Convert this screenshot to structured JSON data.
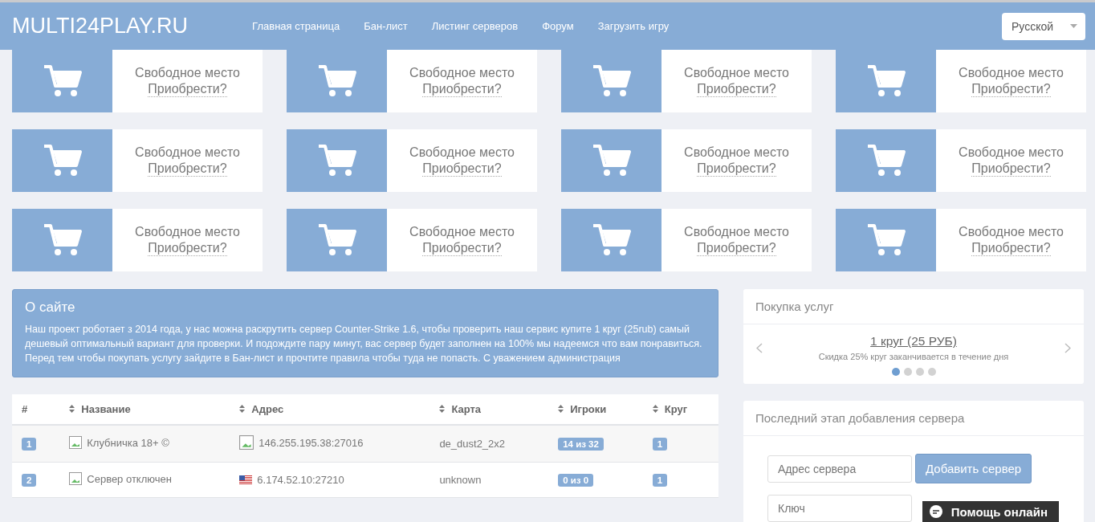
{
  "header": {
    "logo": "MULTI24PLAY.RU",
    "nav": [
      {
        "label": "Главная страница"
      },
      {
        "label": "Бан-лист"
      },
      {
        "label": "Листинг серверов"
      },
      {
        "label": "Форум"
      },
      {
        "label": "Загрузить игру"
      }
    ],
    "language": "Русской"
  },
  "ad_slots": [
    {
      "title": "Свободное место",
      "link": "Приобрести?"
    },
    {
      "title": "Свободное место",
      "link": "Приобрести?"
    },
    {
      "title": "Свободное место",
      "link": "Приобрести?"
    },
    {
      "title": "Свободное место",
      "link": "Приобрести?"
    },
    {
      "title": "Свободное место",
      "link": "Приобрести?"
    },
    {
      "title": "Свободное место",
      "link": "Приобрести?"
    },
    {
      "title": "Свободное место",
      "link": "Приобрести?"
    },
    {
      "title": "Свободное место",
      "link": "Приобрести?"
    },
    {
      "title": "Свободное место",
      "link": "Приобрести?"
    },
    {
      "title": "Свободное место",
      "link": "Приобрести?"
    },
    {
      "title": "Свободное место",
      "link": "Приобрести?"
    },
    {
      "title": "Свободное место",
      "link": "Приобрести?"
    }
  ],
  "about": {
    "title": "О сайте",
    "text": "Наш проект роботает з 2014 года, у нас можна раскрутить сервер Counter-Strike 1.6, чтобы проверить наш сервис купите 1 круг (25rub) самый дешевый оптимальный вариант для проверки. И подождите пару минут, вас сервер будет заполнен на 100% мы надеемся что вам понравиться. Перед тем чтобы покупать услугу зайдите в Бан-лист и прочтите правила чтобы туда не попасть. С уважением администрация"
  },
  "table": {
    "columns": [
      {
        "label": "#",
        "sortable": false
      },
      {
        "label": "Название",
        "sortable": true
      },
      {
        "label": "Адрес",
        "sortable": true
      },
      {
        "label": "Карта",
        "sortable": true
      },
      {
        "label": "Игроки",
        "sortable": true
      },
      {
        "label": "Круг",
        "sortable": true
      }
    ],
    "rows": [
      {
        "number": "1",
        "name": "Клубничка 18+ ©",
        "kind": "broken",
        "address": "146.255.195.38:27016",
        "map": "de_dust2_2x2",
        "players": "14 из 32",
        "round": "1"
      },
      {
        "number": "2",
        "name": "Сервер отключен",
        "kind": "us",
        "address": "6.174.52.10:27210",
        "map": "unknown",
        "players": "0 из 0",
        "round": "1"
      }
    ]
  },
  "services": {
    "title": "Покупка услуг",
    "slide_title": "1 круг (25 РУБ)",
    "slide_text": "Скидка 25% круг заканчивается в течение дня",
    "dots": [
      {
        "selected": true
      },
      {
        "selected": false
      },
      {
        "selected": false
      },
      {
        "selected": false
      }
    ]
  },
  "add_server": {
    "title": "Последний этап добавления сервера",
    "address_placeholder": "Адрес сервера",
    "add_button": "Добавить сервер",
    "key_placeholder": "Ключ"
  },
  "chat": {
    "label": "Помощь онлайн"
  }
}
